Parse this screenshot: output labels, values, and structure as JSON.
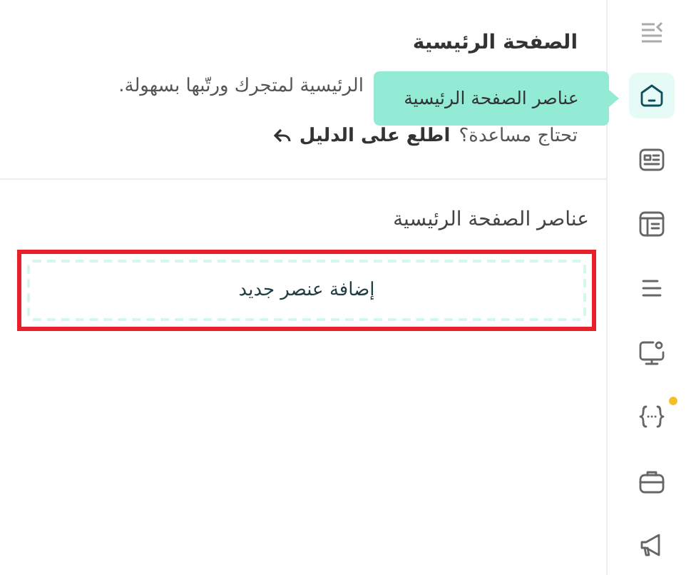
{
  "page": {
    "title": "الصفحة الرئيسية",
    "description": "الرئيسية لمتجرك ورتّبها بسهولة.",
    "help_prompt": "تحتاج مساعدة؟",
    "help_link": "اطلع على الدليل"
  },
  "tooltip": {
    "text": "عناصر الصفحة الرئيسية"
  },
  "section": {
    "title": "عناصر الصفحة الرئيسية",
    "add_button": "إضافة عنصر جديد",
    "highlighted": true
  },
  "sidebar": {
    "items": [
      {
        "selected": true,
        "dot": false
      },
      {
        "selected": false,
        "dot": false
      },
      {
        "selected": false,
        "dot": false
      },
      {
        "selected": false,
        "dot": false
      },
      {
        "selected": false,
        "dot": false
      },
      {
        "selected": false,
        "dot": true
      },
      {
        "selected": false,
        "dot": false
      },
      {
        "selected": false,
        "dot": false
      }
    ]
  }
}
